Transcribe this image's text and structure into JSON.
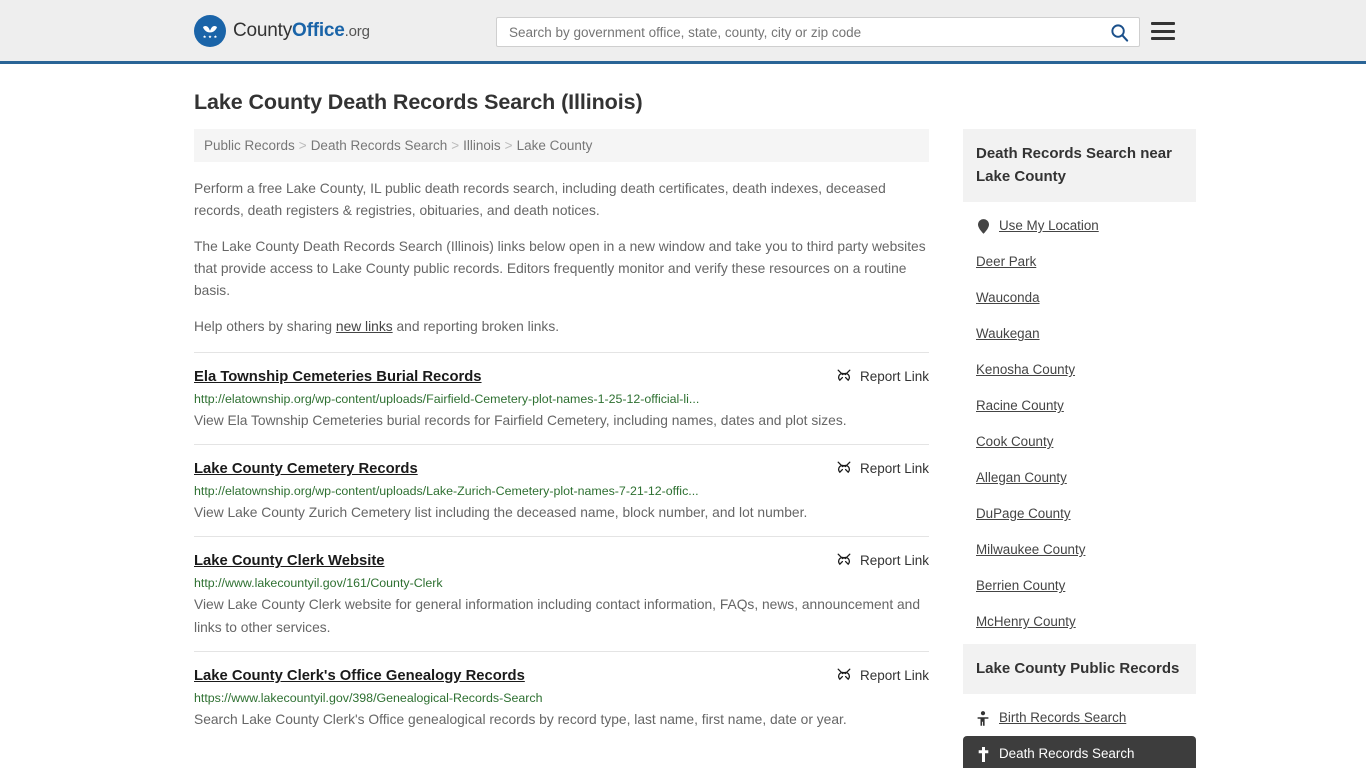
{
  "header": {
    "logo_name_part1": "County",
    "logo_name_part2": "Office",
    "logo_name_part3": ".org",
    "search_placeholder": "Search by government office, state, county, city or zip code",
    "search_value": "",
    "accent_color": "#1a64a8",
    "border_color": "#2a6496"
  },
  "main": {
    "title": "Lake County Death Records Search (Illinois)",
    "breadcrumb": [
      {
        "label": "Public Records"
      },
      {
        "label": "Death Records Search"
      },
      {
        "label": "Illinois"
      },
      {
        "label": "Lake County"
      }
    ],
    "breadcrumb_separator": ">",
    "intro": {
      "paragraph1": "Perform a free Lake County, IL public death records search, including death certificates, death indexes, deceased records, death registers & registries, obituaries, and death notices.",
      "paragraph2": "The Lake County Death Records Search (Illinois) links below open in a new window and take you to third party websites that provide access to Lake County public records. Editors frequently monitor and verify these resources on a routine basis.",
      "paragraph3_before": "Help others by sharing ",
      "paragraph3_link": "new links",
      "paragraph3_after": " and reporting broken links."
    },
    "report_link_label": "Report Link",
    "results": [
      {
        "title": "Ela Township Cemeteries Burial Records",
        "url": "http://elatownship.org/wp-content/uploads/Fairfield-Cemetery-plot-names-1-25-12-official-li...",
        "description": "View Ela Township Cemeteries burial records for Fairfield Cemetery, including names, dates and plot sizes."
      },
      {
        "title": "Lake County Cemetery Records",
        "url": "http://elatownship.org/wp-content/uploads/Lake-Zurich-Cemetery-plot-names-7-21-12-offic...",
        "description": "View Lake County Zurich Cemetery list including the deceased name, block number, and lot number."
      },
      {
        "title": "Lake County Clerk Website",
        "url": "http://www.lakecountyil.gov/161/County-Clerk",
        "description": "View Lake County Clerk website for general information including contact information, FAQs, news, announcement and links to other services."
      },
      {
        "title": "Lake County Clerk's Office Genealogy Records",
        "url": "https://www.lakecountyil.gov/398/Genealogical-Records-Search",
        "description": "Search Lake County Clerk's Office genealogical records by record type, last name, first name, date or year."
      }
    ]
  },
  "sidebar": {
    "nearby": {
      "heading": "Death Records Search near Lake County",
      "use_my_location": "Use My Location",
      "items": [
        {
          "label": "Deer Park"
        },
        {
          "label": "Wauconda"
        },
        {
          "label": "Waukegan"
        },
        {
          "label": "Kenosha County"
        },
        {
          "label": "Racine County"
        },
        {
          "label": "Cook County"
        },
        {
          "label": "Allegan County"
        },
        {
          "label": "DuPage County"
        },
        {
          "label": "Milwaukee County"
        },
        {
          "label": "Berrien County"
        },
        {
          "label": "McHenry County"
        }
      ]
    },
    "public_records": {
      "heading": "Lake County Public Records",
      "items": [
        {
          "label": "Birth Records Search",
          "icon": "baby-icon",
          "active": false
        },
        {
          "label": "Death Records Search",
          "icon": "tombstone-icon",
          "active": true
        }
      ]
    }
  }
}
